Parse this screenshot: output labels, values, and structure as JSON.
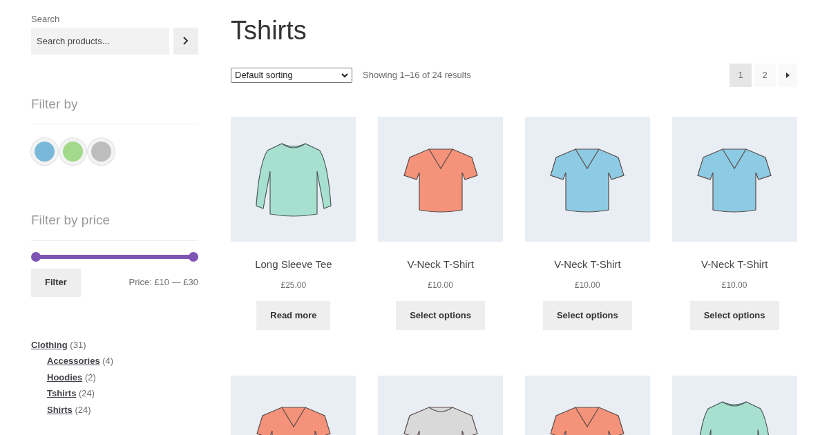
{
  "sidebar": {
    "search": {
      "label": "Search",
      "placeholder": "Search products..."
    },
    "filter_by": {
      "title": "Filter by",
      "swatches": [
        {
          "color": "#7ab8d9"
        },
        {
          "color": "#a3d98a"
        },
        {
          "color": "#bdbdbd"
        }
      ]
    },
    "price_filter": {
      "title": "Filter by price",
      "thumbs": [
        {
          "level": 0
        },
        {
          "level": 1
        }
      ],
      "button": "Filter",
      "reading": "Price: £10 — £30"
    },
    "categories": [
      {
        "name": "Clothing",
        "count": "(31)",
        "children": [
          {
            "name": "Accessories",
            "count": "(4)"
          },
          {
            "name": "Hoodies",
            "count": "(2)"
          },
          {
            "name": "Tshirts",
            "count": "(24)"
          },
          {
            "name": "Shirts",
            "count": "(24)"
          }
        ]
      }
    ]
  },
  "main": {
    "title": "Tshirts",
    "sorting": "Default sorting",
    "result_count": "Showing 1–16 of 24 results",
    "pages": [
      {
        "label": "1",
        "selected": true
      },
      {
        "label": "2",
        "selected": false
      }
    ],
    "products": [
      {
        "kind": "longsleeve",
        "color": "#a8e0cf",
        "name": "Long Sleeve Tee",
        "price": "£25.00",
        "button": "Read more"
      },
      {
        "kind": "vneck",
        "color": "#f4937a",
        "name": "V-Neck T-Shirt",
        "price": "£10.00",
        "button": "Select options"
      },
      {
        "kind": "vneck",
        "color": "#8ccbe3",
        "name": "V-Neck T-Shirt",
        "price": "£10.00",
        "button": "Select options"
      },
      {
        "kind": "vneck",
        "color": "#8ccbe3",
        "name": "V-Neck T-Shirt",
        "price": "£10.00",
        "button": "Select options"
      },
      {
        "kind": "vneck",
        "color": "#f4937a"
      },
      {
        "kind": "crew",
        "color": "#d9d9d9"
      },
      {
        "kind": "vneck",
        "color": "#f4937a"
      },
      {
        "kind": "longsleeve",
        "color": "#a8e0cf"
      }
    ]
  }
}
